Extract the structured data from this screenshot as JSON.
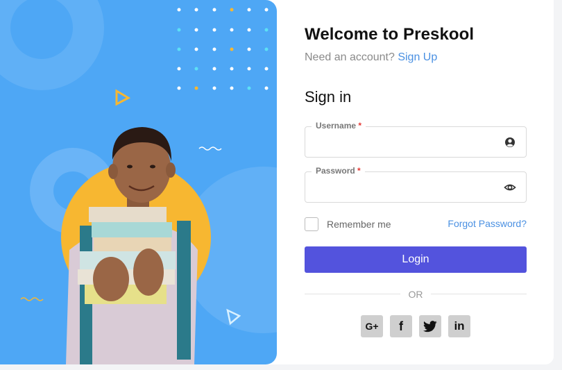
{
  "form": {
    "title": "Welcome to Preskool",
    "subtitle_text": "Need an account?",
    "signup_link": "Sign Up",
    "signin_heading": "Sign in",
    "username": {
      "label": "Username",
      "required_mark": "*",
      "value": "",
      "icon": "user-circle-icon"
    },
    "password": {
      "label": "Password",
      "required_mark": "*",
      "value": "",
      "icon": "eye-icon"
    },
    "remember_label": "Remember me",
    "forgot_link": "Forgot Password?",
    "login_label": "Login",
    "divider_text": "OR",
    "social": [
      {
        "label": "G+",
        "icon": "google-plus-icon"
      },
      {
        "label": "f",
        "icon": "facebook-icon"
      },
      {
        "label": "twitter",
        "icon": "twitter-icon"
      },
      {
        "label": "in",
        "icon": "linkedin-icon"
      }
    ]
  },
  "colors": {
    "hero_bg": "#4ea7f5",
    "accent_yellow": "#f7b731",
    "primary_button": "#5353dd",
    "link": "#4a90e2"
  }
}
